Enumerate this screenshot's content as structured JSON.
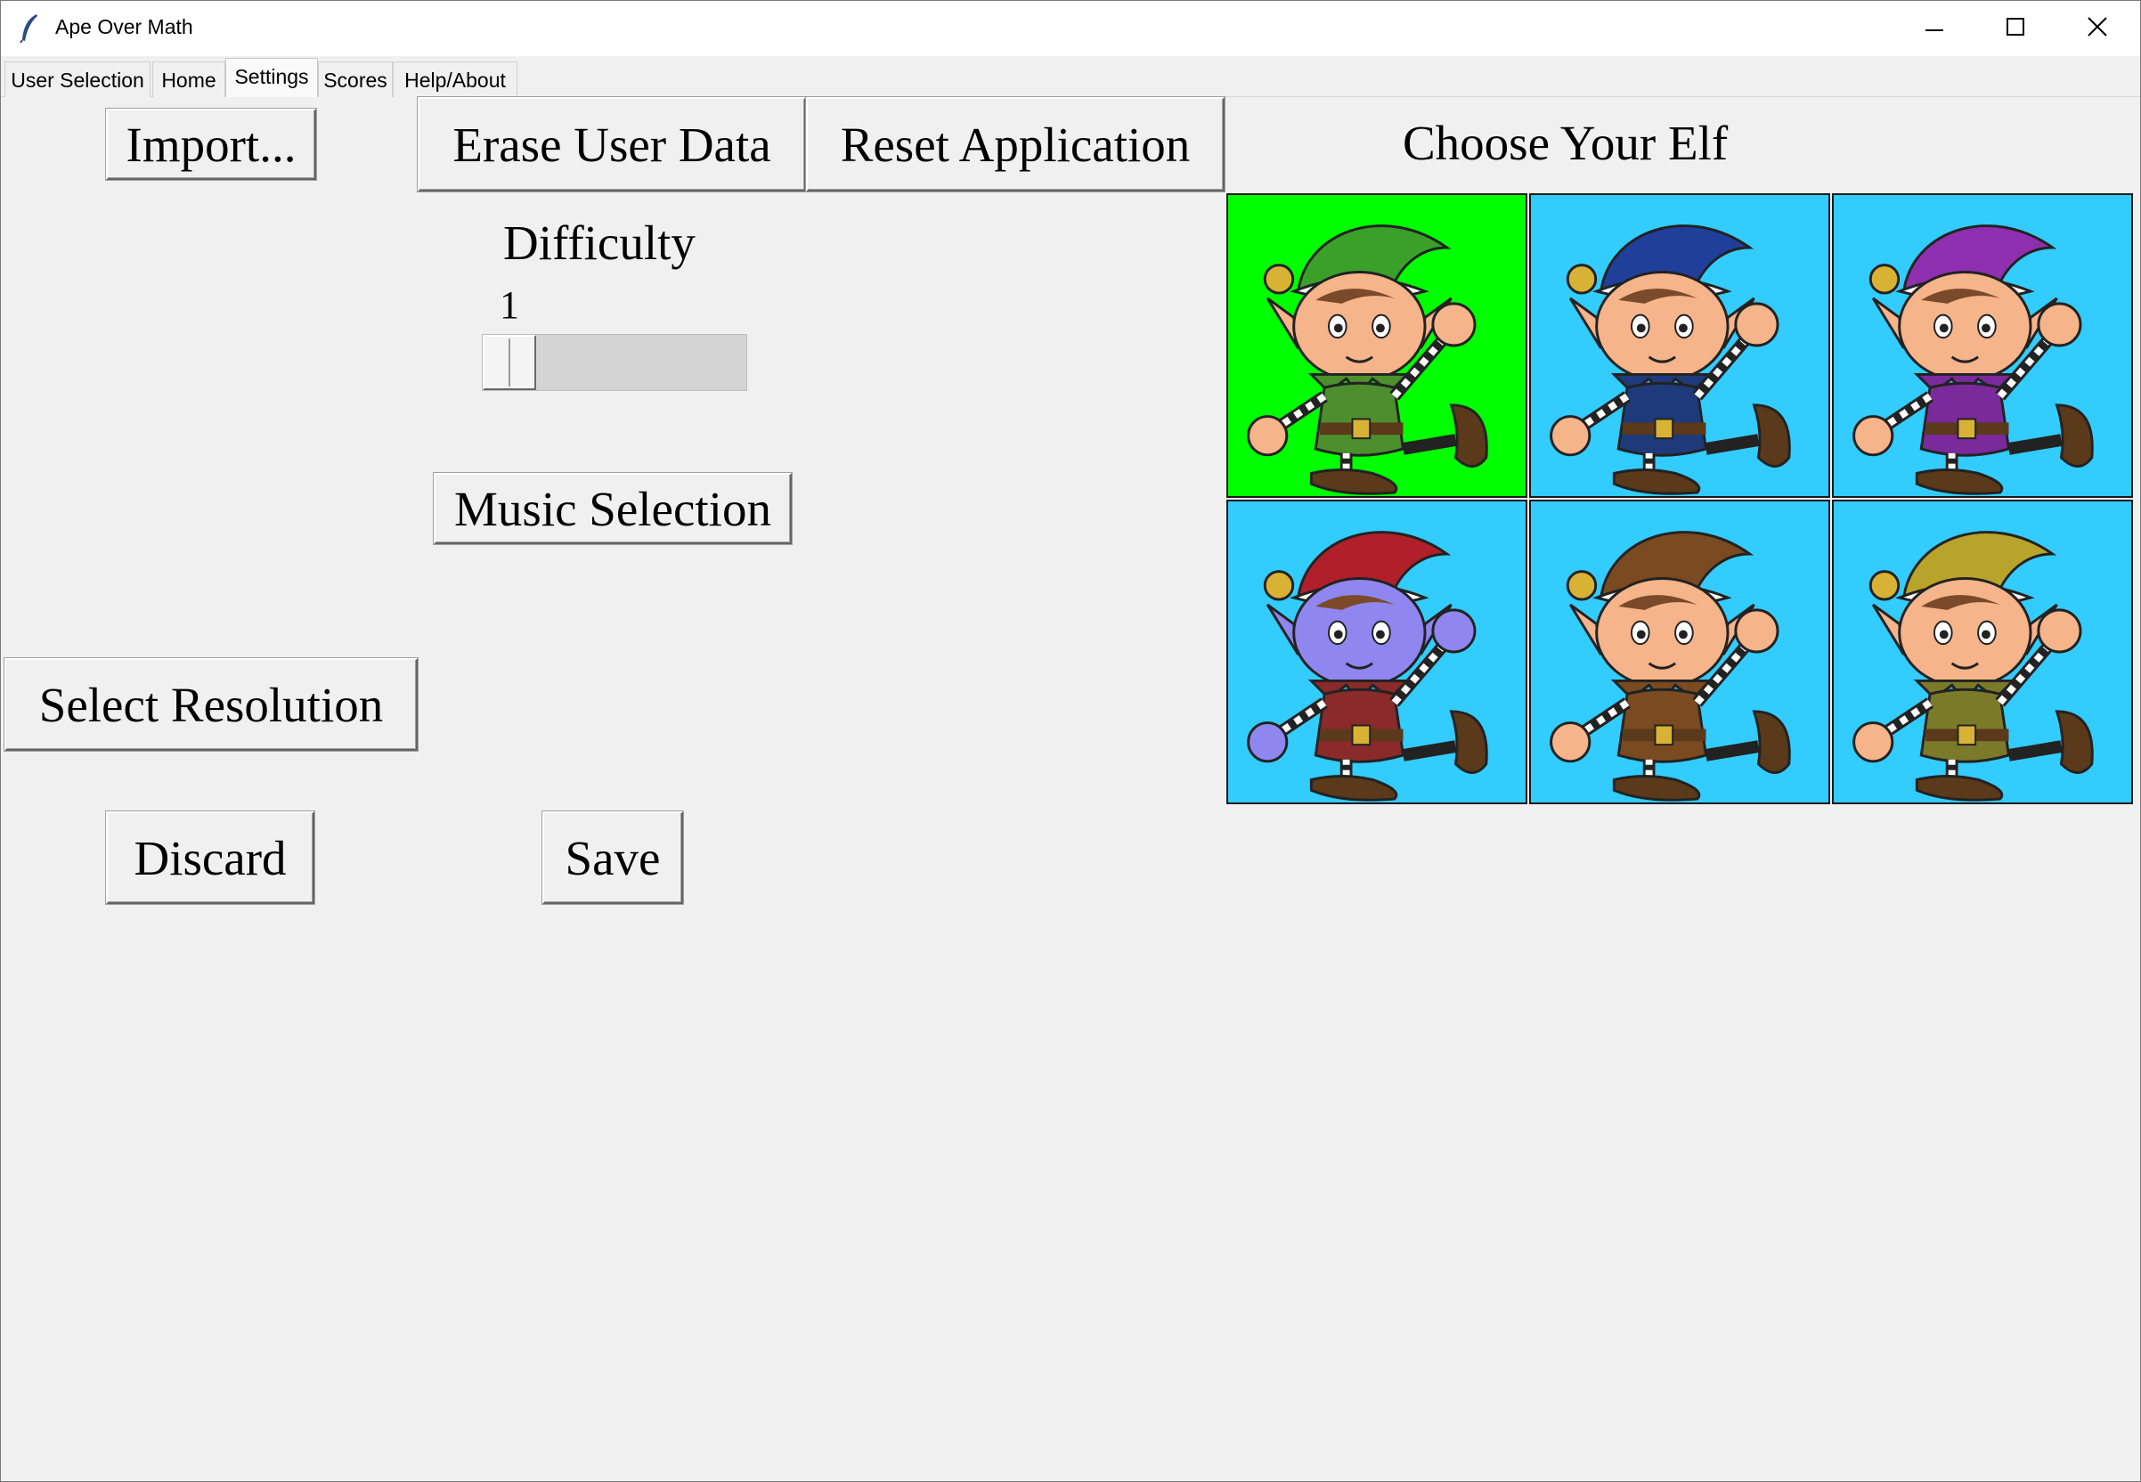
{
  "window": {
    "title": "Ape Over Math",
    "app_icon": "feather-icon",
    "controls": {
      "minimize": "minimize-icon",
      "maximize": "maximize-icon",
      "close": "close-icon"
    }
  },
  "tabs": [
    {
      "label": "User Selection",
      "active": false
    },
    {
      "label": "Home",
      "active": false
    },
    {
      "label": "Settings",
      "active": true
    },
    {
      "label": "Scores",
      "active": false
    },
    {
      "label": "Help/About",
      "active": false
    }
  ],
  "settings": {
    "import_label": "Import...",
    "erase_label": "Erase User Data",
    "reset_label": "Reset Application",
    "difficulty_label": "Difficulty",
    "difficulty_value": "1",
    "music_label": "Music Selection",
    "resolution_label": "Select Resolution",
    "discard_label": "Discard",
    "save_label": "Save"
  },
  "elf_picker": {
    "heading": "Choose Your Elf",
    "selected_color": "#00ff00",
    "tile_color": "#33ccff",
    "elves": [
      {
        "name": "green-elf",
        "hat": "#3aa02a",
        "outfit": "#4c8f2c",
        "skin": "#f5b48a",
        "selected": true
      },
      {
        "name": "blue-elf",
        "hat": "#1f3f9a",
        "outfit": "#1e3a7a",
        "skin": "#f5b48a",
        "selected": false
      },
      {
        "name": "purple-elf",
        "hat": "#8e2fb0",
        "outfit": "#7a2a9a",
        "skin": "#f5b48a",
        "selected": false
      },
      {
        "name": "red-blue-elf",
        "hat": "#b01f2a",
        "outfit": "#8a2a2a",
        "skin": "#8f86f0",
        "selected": false
      },
      {
        "name": "brown-elf",
        "hat": "#7a4a20",
        "outfit": "#7a4a20",
        "skin": "#f5b48a",
        "selected": false
      },
      {
        "name": "olive-elf",
        "hat": "#b8a42a",
        "outfit": "#7a7a2a",
        "skin": "#f5b48a",
        "selected": false
      }
    ]
  }
}
